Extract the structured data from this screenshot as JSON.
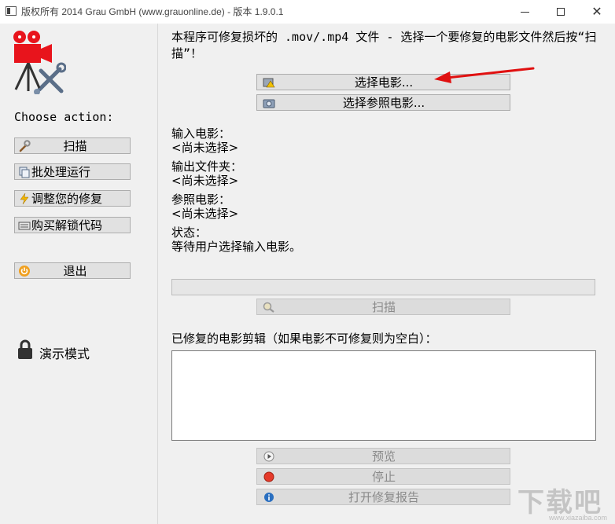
{
  "window": {
    "title": "版权所有 2014 Grau GmbH (www.grauonline.de) - 版本 1.9.0.1"
  },
  "sidebar": {
    "choose_label": "Choose action:",
    "buttons": [
      {
        "label": "扫描",
        "icon": "wrench-icon"
      },
      {
        "label": "批处理运行",
        "icon": "copy-icon"
      },
      {
        "label": "调整您的修复",
        "icon": "lightning-icon"
      },
      {
        "label": "购买解锁代码",
        "icon": "keyboard-icon"
      },
      {
        "label": "退出",
        "icon": "power-icon"
      }
    ],
    "demo_mode_label": "演示模式"
  },
  "main": {
    "instruction": "本程序可修复损坏的 .mov/.mp4 文件 - 选择一个要修复的电影文件然后按“扫描”！",
    "select_movie_button": "选择电影...",
    "select_reference_button": "选择参照电影...",
    "input_movie_label": "输入电影：",
    "input_movie_value": "<尚未选择>",
    "output_folder_label": "输出文件夹：",
    "output_folder_value": "<尚未选择>",
    "reference_movie_label": "参照电影：",
    "reference_movie_value": "<尚未选择>",
    "status_label": "状态：",
    "status_value": "等待用户选择输入电影。",
    "progress": 0,
    "scan_button": "扫描",
    "repaired_clips_label": "已修复的电影剪辑（如果电影不可修复则为空白）：",
    "preview_button": "预览",
    "stop_button": "停止",
    "open_report_button": "打开修复报告"
  },
  "colors": {
    "logo_red": "#e8141c",
    "arrow_red": "#e01010",
    "stop_red": "#e53a2a",
    "info_blue": "#2a6fc0"
  }
}
